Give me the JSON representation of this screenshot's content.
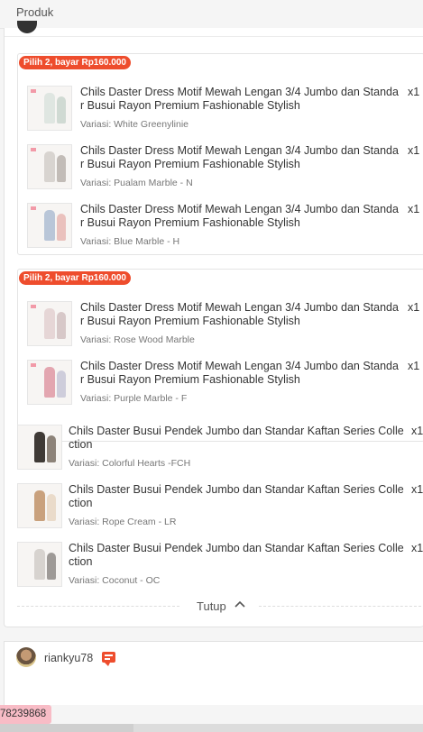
{
  "header": {
    "title": "Produk"
  },
  "bundles": [
    {
      "badge": "Pilih 2, bayar Rp160.000",
      "items": [
        {
          "name_line1": "Chils Daster Dress Motif Mewah Lengan 3/4 Jumbo dan Standa",
          "name_line2": "r Busui Rayon Premium Fashionable Stylish",
          "qty": "x1",
          "variant": "Variasi: White Greenylinie"
        },
        {
          "name_line1": "Chils Daster Dress Motif Mewah Lengan 3/4 Jumbo dan Standa",
          "name_line2": "r Busui Rayon Premium Fashionable Stylish",
          "qty": "x1",
          "variant": "Variasi: Pualam Marble - N"
        },
        {
          "name_line1": "Chils Daster Dress Motif Mewah Lengan 3/4 Jumbo dan Standa",
          "name_line2": "r Busui Rayon Premium Fashionable Stylish",
          "qty": "x1",
          "variant": "Variasi: Blue Marble - H"
        }
      ]
    },
    {
      "badge": "Pilih 2, bayar Rp160.000",
      "items": [
        {
          "name_line1": "Chils Daster Dress Motif Mewah Lengan 3/4 Jumbo dan Standa",
          "name_line2": "r Busui Rayon Premium Fashionable Stylish",
          "qty": "x1",
          "variant": "Variasi: Rose Wood Marble"
        },
        {
          "name_line1": "Chils Daster Dress Motif Mewah Lengan 3/4 Jumbo dan Standa",
          "name_line2": "r Busui Rayon Premium Fashionable Stylish",
          "qty": "x1",
          "variant": "Variasi: Purple Marble - F"
        }
      ]
    }
  ],
  "items": [
    {
      "name_line1": "Chils Daster Busui Pendek Jumbo dan Standar Kaftan Series Colle",
      "name_line2": "ction",
      "qty": "x1",
      "variant": "Variasi: Colorful Hearts -FCH"
    },
    {
      "name_line1": "Chils Daster Busui Pendek Jumbo dan Standar Kaftan Series Colle",
      "name_line2": "ction",
      "qty": "x1",
      "variant": "Variasi: Rope Cream - LR"
    },
    {
      "name_line1": "Chils Daster Busui Pendek Jumbo dan Standar Kaftan Series Colle",
      "name_line2": "ction",
      "qty": "x1",
      "variant": "Variasi: Coconut - OC"
    }
  ],
  "collapse": {
    "label": "Tutup",
    "icon": "chevron-up-icon"
  },
  "seller": {
    "name": "riankyu78",
    "icon": "chat-icon"
  },
  "footer": {
    "phone_chip": "78239868"
  },
  "colors": {
    "accent": "#ee4d2d",
    "chip": "#f8bcc6"
  }
}
